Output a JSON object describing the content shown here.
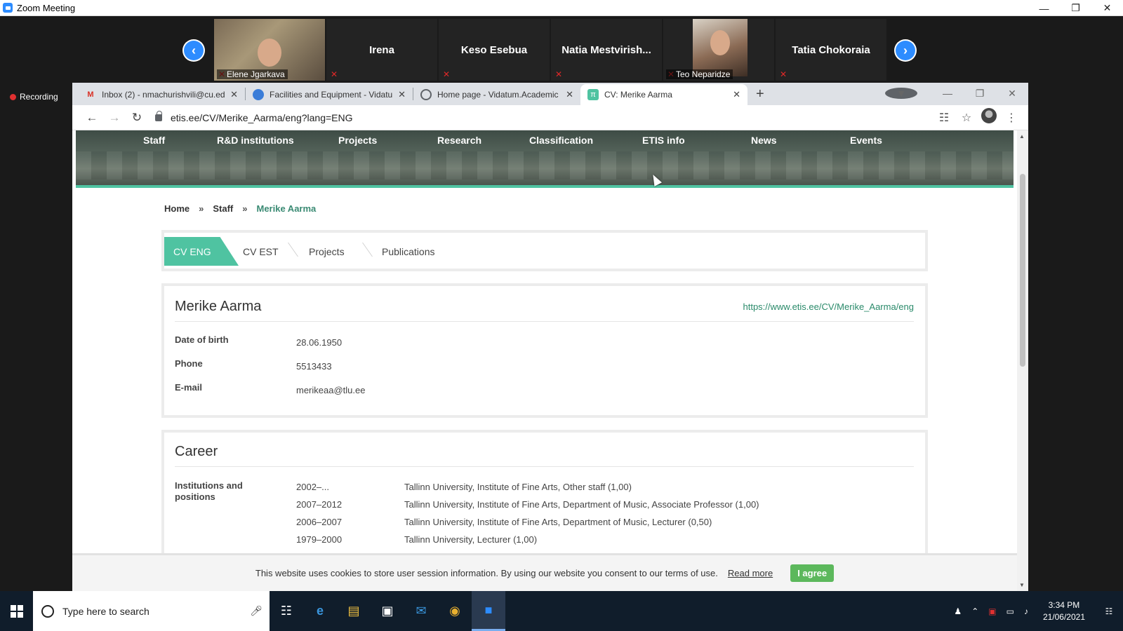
{
  "zoom": {
    "window_title": "Zoom Meeting",
    "recording_label": "Recording",
    "participants": [
      {
        "name": "Elene Jgarkava",
        "video": true
      },
      {
        "name": "Irena",
        "video": false
      },
      {
        "name": "Keso Esebua",
        "video": false
      },
      {
        "name": "Natia  Mestvirish...",
        "video": false
      },
      {
        "name": "Teo Neparidze",
        "video": true
      },
      {
        "name": "Tatia Chokoraia",
        "video": false
      }
    ]
  },
  "browser": {
    "tabs": [
      {
        "title": "Inbox (2) - nmachurishvili@cu.ed",
        "icon": "gmail-icon"
      },
      {
        "title": "Facilities and Equipment - Vidatu",
        "icon": "vidatum-icon"
      },
      {
        "title": "Home page - Vidatum.Academic",
        "icon": "globe-icon"
      },
      {
        "title": "CV: Merike Aarma",
        "icon": "etis-icon",
        "active": true
      }
    ],
    "url": "etis.ee/CV/Merike_Aarma/eng?lang=ENG"
  },
  "site": {
    "nav": [
      "Staff",
      "R&D institutions",
      "Projects",
      "Research",
      "Classification",
      "ETIS info",
      "News",
      "Events"
    ],
    "breadcrumb": {
      "home": "Home",
      "sep": "»",
      "staff": "Staff",
      "current": "Merike Aarma"
    },
    "cv_tabs": [
      "CV ENG",
      "CV EST",
      "Projects",
      "Publications"
    ],
    "profile": {
      "name": "Merike Aarma",
      "url": "https://www.etis.ee/CV/Merike_Aarma/eng",
      "rows": [
        {
          "label": "Date of birth",
          "value": "28.06.1950"
        },
        {
          "label": "Phone",
          "value": "5513433"
        },
        {
          "label": "E-mail",
          "value": "merikeaa@tlu.ee"
        }
      ]
    },
    "career": {
      "title": "Career",
      "label": "Institutions and positions",
      "entries": [
        {
          "years": "2002–...",
          "desc": "Tallinn University, Institute of Fine Arts, Other staff (1,00)"
        },
        {
          "years": "2007–2012",
          "desc": "Tallinn University, Institute of Fine Arts, Department of Music, Associate Professor (1,00)"
        },
        {
          "years": "2006–2007",
          "desc": "Tallinn University, Institute of Fine Arts, Department of Music, Lecturer (0,50)"
        },
        {
          "years": "1979–2000",
          "desc": "Tallinn University, Lecturer (1,00)"
        }
      ]
    },
    "cookie": {
      "text": "This website uses cookies to store user session information. By using our website you consent to our terms of use.",
      "read_more": "Read more",
      "agree": "I agree"
    }
  },
  "taskbar": {
    "search_placeholder": "Type here to search",
    "time": "3:34 PM",
    "date": "21/06/2021"
  }
}
